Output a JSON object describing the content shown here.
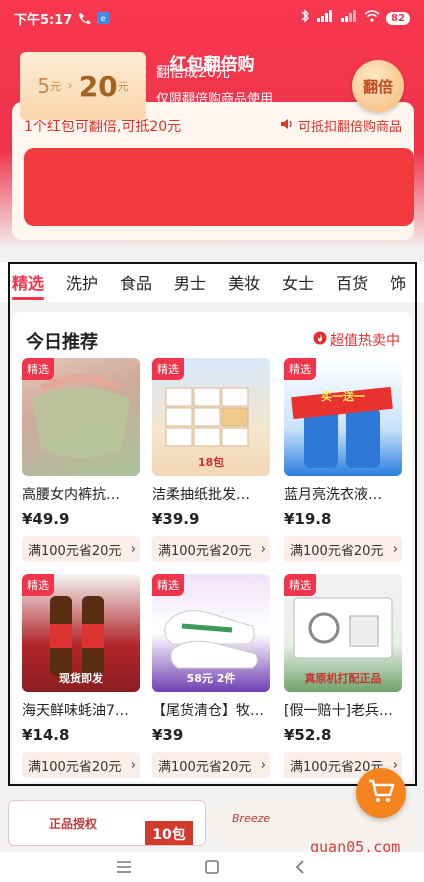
{
  "status_bar": {
    "time": "下午5:17",
    "battery": "82"
  },
  "nav": {
    "title": "红包翻倍购"
  },
  "coupon": {
    "line1": "1个红包可翻倍,可抵20元",
    "hint": "可抵扣翻倍购商品",
    "from_amount": "5",
    "from_unit": "元",
    "to_amount": "20",
    "to_unit": "元",
    "mid_line1": "翻倍成20元",
    "mid_line2": "仅限翻倍购商品使用",
    "button": "翻倍"
  },
  "tabs": [
    "精选",
    "洗护",
    "食品",
    "男士",
    "美妆",
    "女士",
    "百货",
    "饰"
  ],
  "recommend": {
    "title": "今日推荐",
    "hot": "超值热卖中",
    "products": [
      {
        "tag": "精选",
        "name": "高腰女内裤抗…",
        "price": "¥49.9",
        "coupon": "满100元省20元",
        "art": ""
      },
      {
        "tag": "精选",
        "name": "洁柔抽纸批发…",
        "price": "¥39.9",
        "coupon": "满100元省20元",
        "art": "18包"
      },
      {
        "tag": "精选",
        "name": "蓝月亮洗衣液…",
        "price": "¥19.8",
        "coupon": "满100元省20元",
        "art": "买一送一"
      },
      {
        "tag": "精选",
        "name": "海天鲜味蚝油7…",
        "price": "¥14.8",
        "coupon": "满100元省20元",
        "art": "现货即发"
      },
      {
        "tag": "精选",
        "name": "【尾货清仓】牧…",
        "price": "¥39",
        "coupon": "满100元省20元",
        "art": "58元 2件"
      },
      {
        "tag": "精选",
        "name": "[假一赔十]老兵…",
        "price": "¥52.8",
        "coupon": "满100元省20元",
        "art": "真原机打配正品"
      }
    ]
  },
  "bottom": {
    "b1_label": "正品授权",
    "b1_pack": "10包",
    "b2_label": "Breeze"
  },
  "watermark": "quan05.com"
}
